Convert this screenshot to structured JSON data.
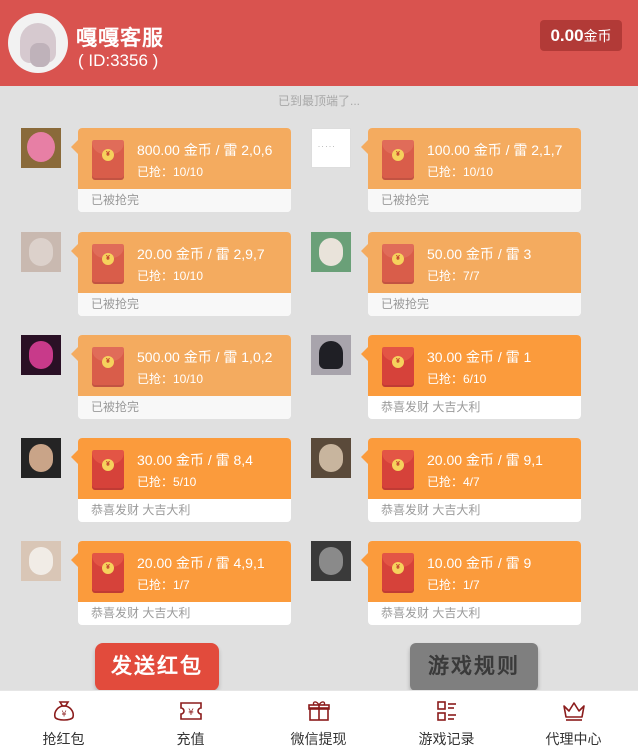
{
  "header": {
    "name": "嘎嘎客服",
    "id_text": "( ID:3356 )",
    "balance_amount": "0.00",
    "balance_unit": "金币"
  },
  "top_tip": "已到最顶端了...",
  "packets": [
    {
      "amount": "800.00 金币 / 雷 2,0,6",
      "grabbed": "已抢：10/10",
      "status": "已被抢完"
    },
    {
      "amount": "100.00 金币 / 雷 2,1,7",
      "grabbed": "已抢：10/10",
      "status": "已被抢完"
    },
    {
      "amount": "20.00 金币 / 雷 2,9,7",
      "grabbed": "已抢：10/10",
      "status": "已被抢完"
    },
    {
      "amount": "50.00 金币 / 雷 3",
      "grabbed": "已抢：7/7",
      "status": "已被抢完"
    },
    {
      "amount": "500.00 金币 / 雷 1,0,2",
      "grabbed": "已抢：10/10",
      "status": "已被抢完"
    },
    {
      "amount": "30.00 金币 / 雷 1",
      "grabbed": "已抢：6/10",
      "status": "恭喜发财 大吉大利"
    },
    {
      "amount": "30.00 金币 / 雷 8,4",
      "grabbed": "已抢：5/10",
      "status": "恭喜发财 大吉大利"
    },
    {
      "amount": "20.00 金币 / 雷 9,1",
      "grabbed": "已抢：4/7",
      "status": "恭喜发财 大吉大利"
    },
    {
      "amount": "20.00 金币 / 雷 4,9,1",
      "grabbed": "已抢：1/7",
      "status": "恭喜发财 大吉大利"
    },
    {
      "amount": "10.00 金币 / 雷 9",
      "grabbed": "已抢：1/7",
      "status": "恭喜发财 大吉大利"
    }
  ],
  "buttons": {
    "send": "发送红包",
    "rules": "游戏规则"
  },
  "tabs": [
    {
      "label": "抢红包",
      "icon": "money-bag-icon"
    },
    {
      "label": "充值",
      "icon": "ticket-icon"
    },
    {
      "label": "微信提现",
      "icon": "gift-icon"
    },
    {
      "label": "游戏记录",
      "icon": "list-icon"
    },
    {
      "label": "代理中心",
      "icon": "crown-icon"
    }
  ],
  "colors": {
    "header": "#d9534f",
    "packet_open": "#f4ab5f",
    "packet_available": "#fb9b3c",
    "send_button": "#e24b3c"
  }
}
